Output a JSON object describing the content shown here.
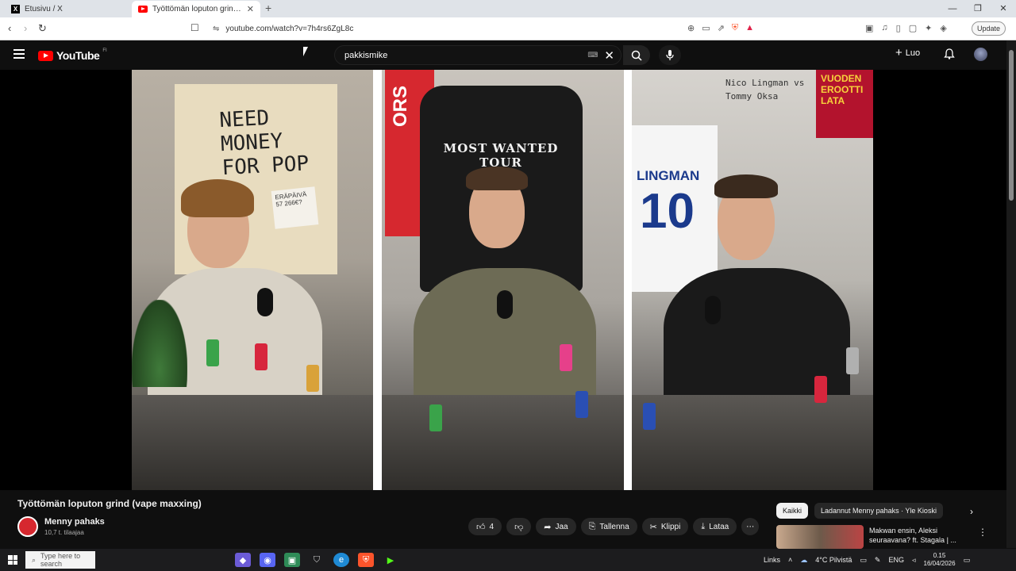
{
  "browser": {
    "tabs": [
      {
        "label": "Etusivu / X",
        "active": false,
        "icon": "x-logo-icon"
      },
      {
        "label": "Työttömän loputon grind (vape...",
        "active": true,
        "icon": "youtube-icon"
      }
    ],
    "url": "youtube.com/watch?v=7h4rs6ZgL8c",
    "update_label": "Update"
  },
  "youtube": {
    "logo_text": "YouTube",
    "region": "FI",
    "search_query": "pakkismike",
    "create_label": "Luo"
  },
  "video": {
    "panel1": {
      "poster_text": "NEED MONEY FOR POP",
      "note_text": "ERÄPÄIVÄ 57 266€?"
    },
    "panel2": {
      "banner_text": "ORS",
      "hoodie_text": "MOST WANTED TOUR"
    },
    "panel3": {
      "wall_text_1": "Nico Lingman vs",
      "wall_text_2": "Tommy Oksa",
      "jersey_name": "LINGMAN",
      "jersey_number": "10",
      "promo_text": "VUODEN EROOTTI LATA"
    }
  },
  "below_player": {
    "title": "Työttömän loputon grind (vape maxxing)",
    "channel_name": "Menny pahaks",
    "subscribers": "10,7 t. tilaajaa",
    "likes": "4",
    "share_label": "Jaa",
    "save_label": "Tallenna",
    "clip_label": "Klippi",
    "download_label": "Lataa"
  },
  "sidebar": {
    "chips": [
      {
        "label": "Kaikki",
        "selected": true
      },
      {
        "label": "Ladannut Menny pahaks · Yle Kioski",
        "selected": false
      }
    ],
    "recommendation_title": "Makwan ensin, Aleksi seuraavana? ft. Stagala | ..."
  },
  "taskbar": {
    "search_placeholder": "Type here to search",
    "links_label": "Links",
    "weather": "4°C Pilvistä",
    "language": "ENG",
    "time": "0.15",
    "date": "16/04/2026"
  },
  "colors": {
    "youtube_red": "#ff0000",
    "bg": "#0f0f0f",
    "chip_bg": "#272727"
  }
}
